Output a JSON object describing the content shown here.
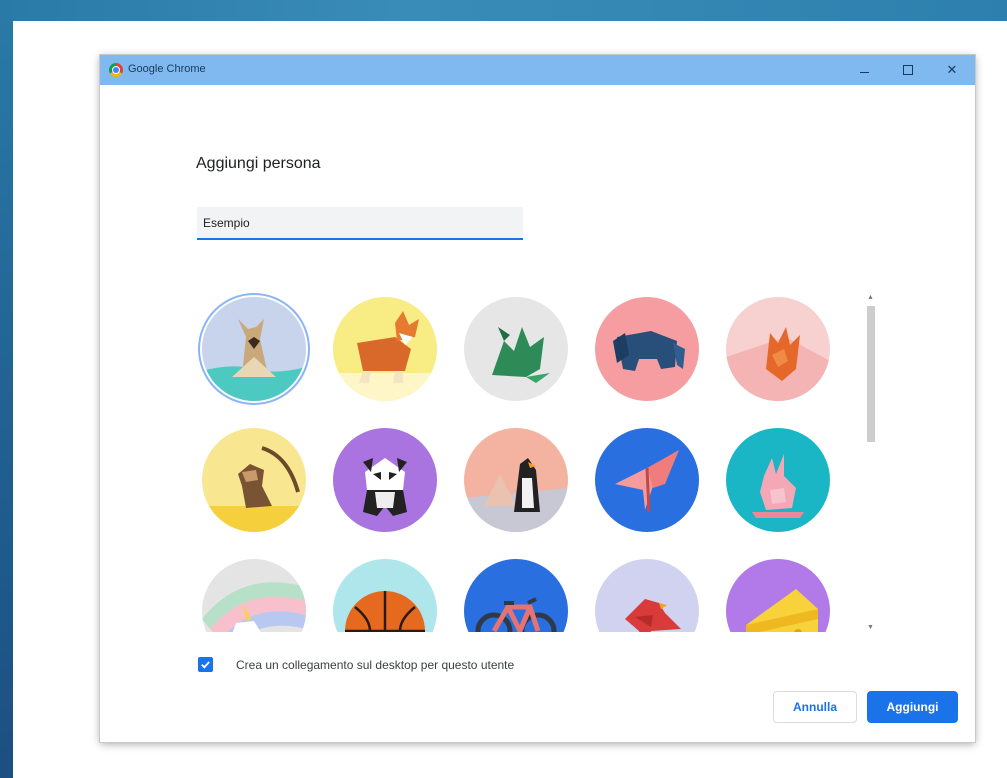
{
  "window": {
    "title": "Google Chrome",
    "titlebar_color": "#7fb9f0"
  },
  "dialog": {
    "heading": "Aggiungi persona",
    "name_input_value": "Esempio",
    "checkbox_label": "Crea un collegamento sul desktop per questo utente",
    "checkbox_checked": true,
    "cancel_label": "Annulla",
    "add_label": "Aggiungi",
    "accent_color": "#1a73e8"
  },
  "avatars": [
    {
      "name": "cat",
      "bg": "#c8d4ec",
      "selected": true
    },
    {
      "name": "corgi",
      "bg": "#f8ec84"
    },
    {
      "name": "dragon",
      "bg": "#e6e6e6"
    },
    {
      "name": "elephant",
      "bg": "#f59da0"
    },
    {
      "name": "fox",
      "bg": "#f7d0d0"
    },
    {
      "name": "monkey",
      "bg": "#f8e690"
    },
    {
      "name": "panda",
      "bg": "#a974e0"
    },
    {
      "name": "penguin",
      "bg": "#f4b2a0"
    },
    {
      "name": "butterfly",
      "bg": "#2a6fe0"
    },
    {
      "name": "rabbit",
      "bg": "#1bb6c6"
    },
    {
      "name": "unicorn",
      "bg": "#e4e4e4"
    },
    {
      "name": "basketball",
      "bg": "#aee6ec"
    },
    {
      "name": "bike",
      "bg": "#2a6fe0"
    },
    {
      "name": "bird",
      "bg": "#d0d2f0"
    },
    {
      "name": "cheese",
      "bg": "#b27ae8"
    }
  ]
}
